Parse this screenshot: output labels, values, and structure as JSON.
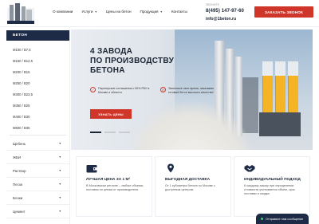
{
  "header": {
    "logo_icon": "concrete-plant-logo-icon",
    "nav": [
      {
        "label": "О компании",
        "has_dropdown": false
      },
      {
        "label": "Услуги",
        "has_dropdown": true
      },
      {
        "label": "Цены на бетон",
        "has_dropdown": false
      },
      {
        "label": "Продукция",
        "has_dropdown": true
      },
      {
        "label": "Контакты",
        "has_dropdown": false
      }
    ],
    "phone_hint": "ЗВОНИТЕ",
    "phone": "8(495) 147-97-60",
    "email": "info@1beton.ru",
    "call_button": "ЗАКАЗАТЬ ЗВОНОК"
  },
  "sidebar": {
    "heading": "БЕТОН",
    "grades": [
      "М100 / В7,5",
      "М150 / В12,5",
      "М200 / В15",
      "М250 / В20",
      "М300 / В22,5",
      "М350 / В25",
      "М400 / В30",
      "М500 / В35"
    ],
    "categories": [
      "Щебень",
      "ЖБИ",
      "Раствор",
      "Песок",
      "Блоки",
      "Цемент"
    ]
  },
  "hero": {
    "title_line1": "4 ЗАВОДА",
    "title_line2": "ПО ПРОИЗВОДСТВУ",
    "title_line3": "БЕТОНА",
    "feature1": "Партнерские соглашения с 90% РБУ в Москве и области",
    "feature2": "Экономьте свое время, заказывая готовый бетон высокого качества!",
    "button": "УЗНАТЬ ЦЕНЫ",
    "slides": 3,
    "active_slide": 1
  },
  "benefits": [
    {
      "icon": "wallet-icon",
      "title": "ЛУЧШАЯ ЦЕНА ЗА 1 М³",
      "text": "В Московском регионе – любые объемы поставок по ценам от производителя"
    },
    {
      "icon": "location-pin-icon",
      "title": "ВЫГОДНАЯ ДОСТАВКА",
      "text": "От 1 кубометра бетона по Москве с доступным центром"
    },
    {
      "icon": "handshake-icon",
      "title": "ИНДИВИДУАЛЬНЫЙ ПОДХОД",
      "text": "К каждому заказу при определении стоимости учитывается объем, срок поставки и скидка"
    }
  ],
  "chat": {
    "label": "Отправьте нам сообщение"
  },
  "colors": {
    "accent": "#d0352a",
    "navy": "#1d2b47",
    "silo": "#f5b426"
  }
}
